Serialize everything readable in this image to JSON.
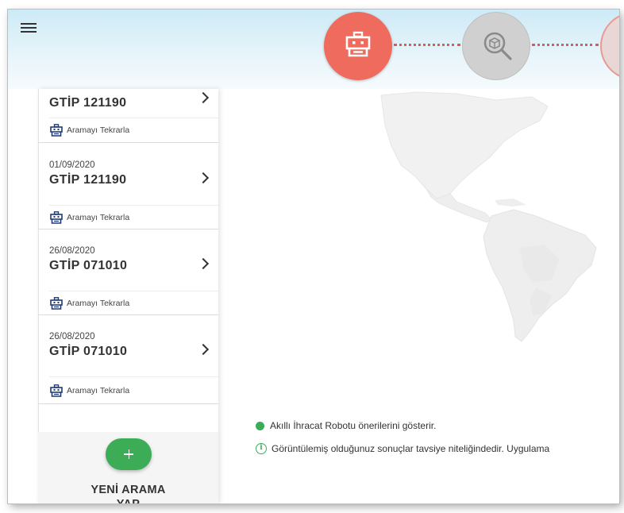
{
  "header": {
    "steps": [
      {
        "icon": "robot-icon",
        "state": "active",
        "color": "#ef6b5e"
      },
      {
        "icon": "package-search-icon",
        "state": "inactive",
        "color": "#d0d0d0"
      },
      {
        "icon": "step-3-icon",
        "state": "inactive",
        "color": "#e9d7d6"
      }
    ],
    "connector_color": "#e25a4f"
  },
  "history": {
    "repeat_label": "Aramayı Tekrarla",
    "items": [
      {
        "date": "",
        "code": "GTİP 121190",
        "repeat_label": "Aramayı Tekrarla"
      },
      {
        "date": "01/09/2020",
        "code": "GTİP 121190",
        "repeat_label": "Aramayı Tekrarla"
      },
      {
        "date": "26/08/2020",
        "code": "GTİP 071010",
        "repeat_label": "Aramayı Tekrarla"
      },
      {
        "date": "26/08/2020",
        "code": "GTİP 071010",
        "repeat_label": "Aramayı Tekrarla"
      }
    ]
  },
  "new_search": {
    "label_line1": "YENİ ARAMA",
    "label_line2": "YAP",
    "button_color": "#3cad56"
  },
  "legend": {
    "robot_suggestion": "Akıllı İhracat Robotu önerilerini gösterir.",
    "disclaimer": "Görüntülemiş olduğunuz sonuçlar tavsiye niteliğindedir. Uygulama",
    "marker_color": "#3cad56"
  }
}
